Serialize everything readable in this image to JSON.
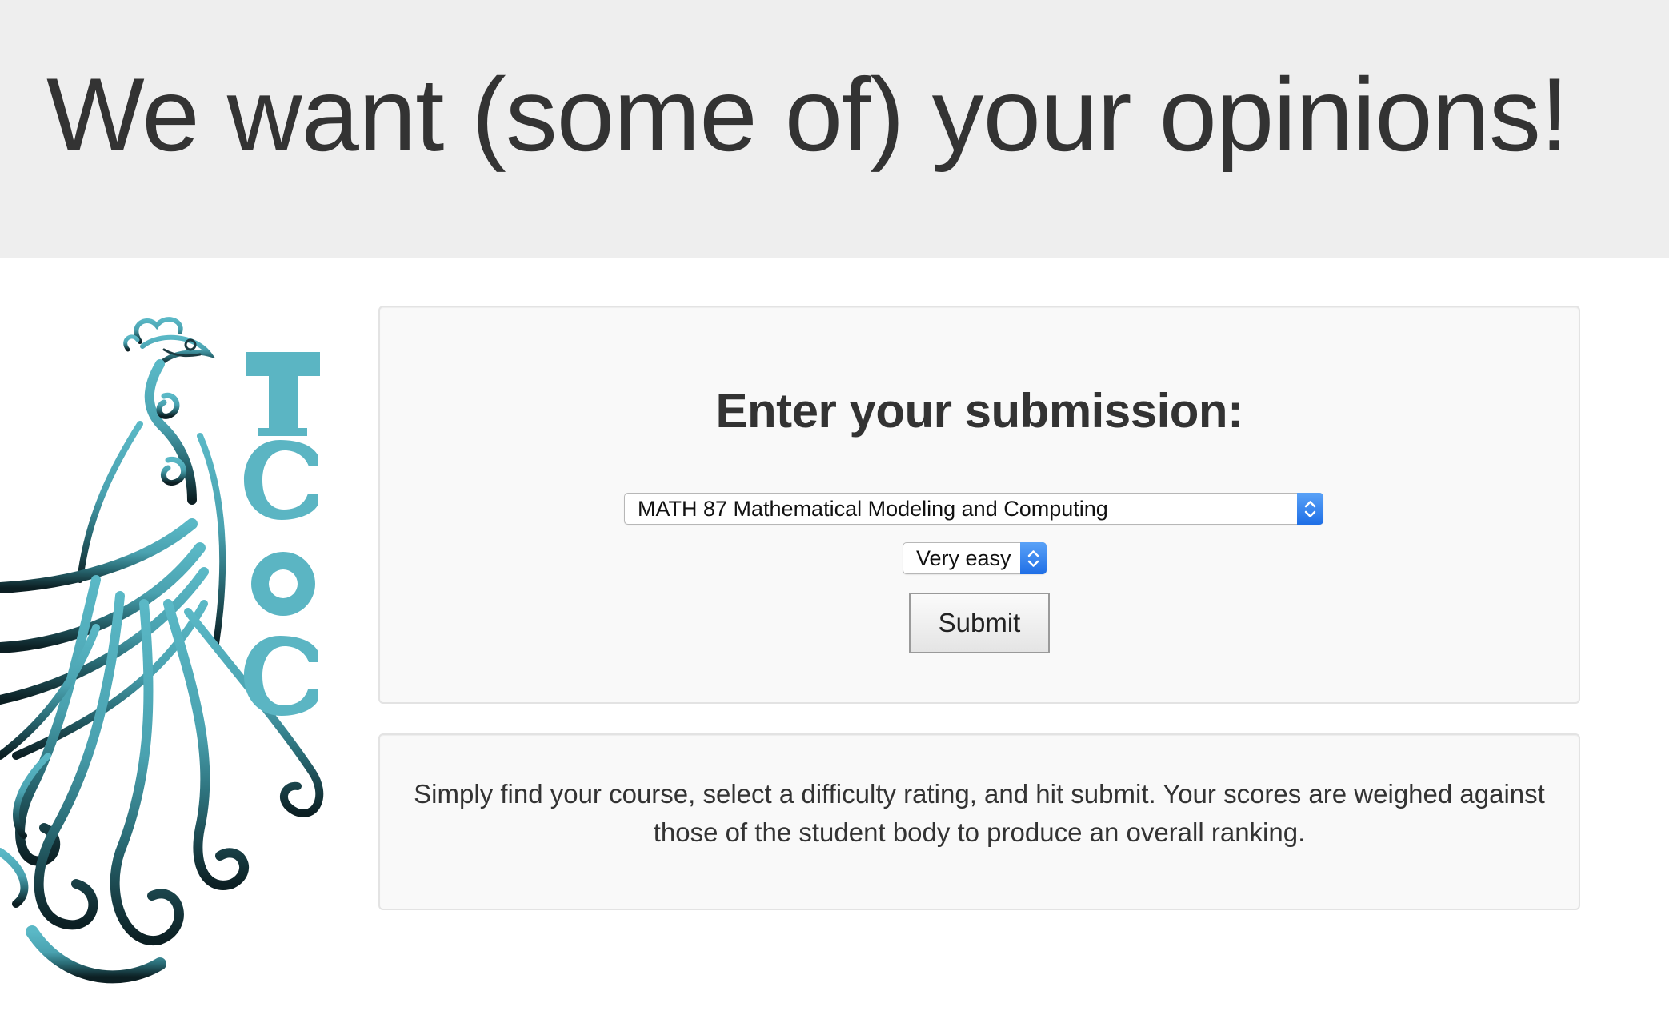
{
  "header": {
    "title": "We want (some of) your opinions!",
    "background_color": "#eeeeee"
  },
  "logo": {
    "text": "TCOC",
    "icon": "peacock-logo-icon",
    "colors": [
      "#5bb5c3",
      "#0d2327"
    ]
  },
  "form": {
    "title": "Enter your submission:",
    "course_select": {
      "selected": "MATH 87 Mathematical Modeling and Computing",
      "icon": "updown-chevron-icon"
    },
    "rating_select": {
      "selected": "Very easy",
      "icon": "updown-chevron-icon"
    },
    "submit_label": "Submit",
    "accent_color": "#1f6fe6"
  },
  "info": {
    "text": "Simply find your course, select a difficulty rating, and hit submit. Your scores are weighed against those of the student body to produce an overall ranking."
  }
}
